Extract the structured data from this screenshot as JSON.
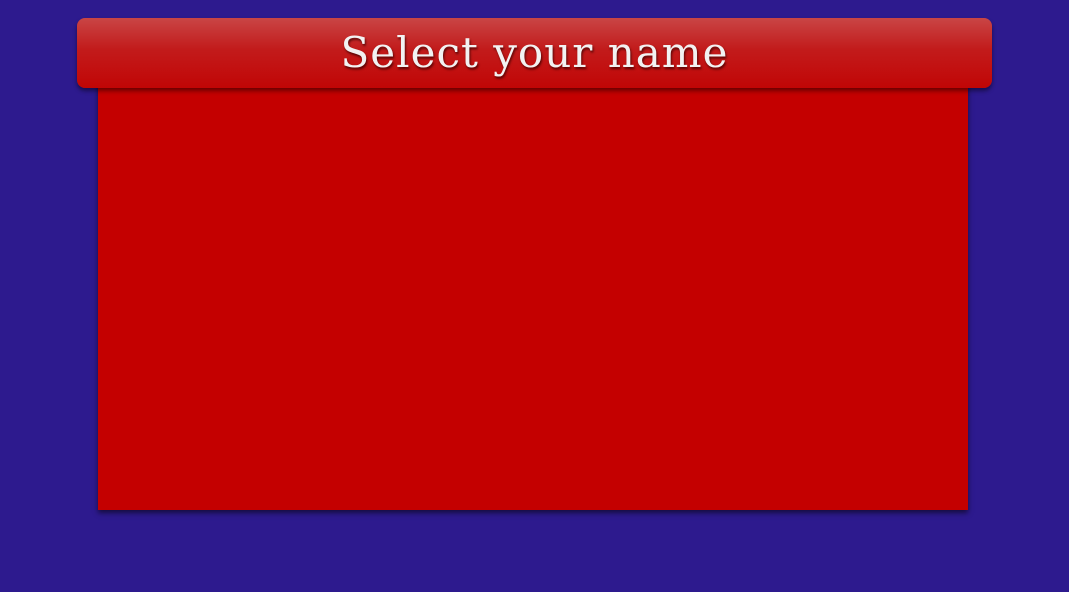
{
  "dialog": {
    "title": "Select your name",
    "names": []
  },
  "colors": {
    "background": "#2d1a8e",
    "panel": "#c40000",
    "header": "#c21b1b",
    "title_text": "#f2f2f2"
  }
}
